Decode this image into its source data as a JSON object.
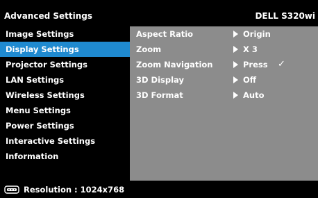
{
  "header": {
    "title": "Advanced Settings",
    "model": "DELL S320wi"
  },
  "sidebar": {
    "items": [
      {
        "label": "Image Settings",
        "active": false
      },
      {
        "label": "Display Settings",
        "active": true
      },
      {
        "label": "Projector Settings",
        "active": false
      },
      {
        "label": "LAN Settings",
        "active": false
      },
      {
        "label": "Wireless Settings",
        "active": false
      },
      {
        "label": "Menu Settings",
        "active": false
      },
      {
        "label": "Power Settings",
        "active": false
      },
      {
        "label": "Interactive Settings",
        "active": false
      },
      {
        "label": "Information",
        "active": false
      }
    ]
  },
  "main": {
    "rows": [
      {
        "label": "Aspect Ratio",
        "value": "Origin",
        "check": ""
      },
      {
        "label": "Zoom",
        "value": "X 3",
        "check": ""
      },
      {
        "label": "Zoom Navigation",
        "value": "Press",
        "check": "✓"
      },
      {
        "label": "3D Display",
        "value": "Off",
        "check": ""
      },
      {
        "label": "3D Format",
        "value": "Auto",
        "check": ""
      }
    ]
  },
  "footer": {
    "icon": "display-connector-icon",
    "resolution": "Resolution : 1024x768"
  },
  "colors": {
    "highlight": "#1f8ad0",
    "panel": "#8c8c8c",
    "background": "#000000"
  }
}
